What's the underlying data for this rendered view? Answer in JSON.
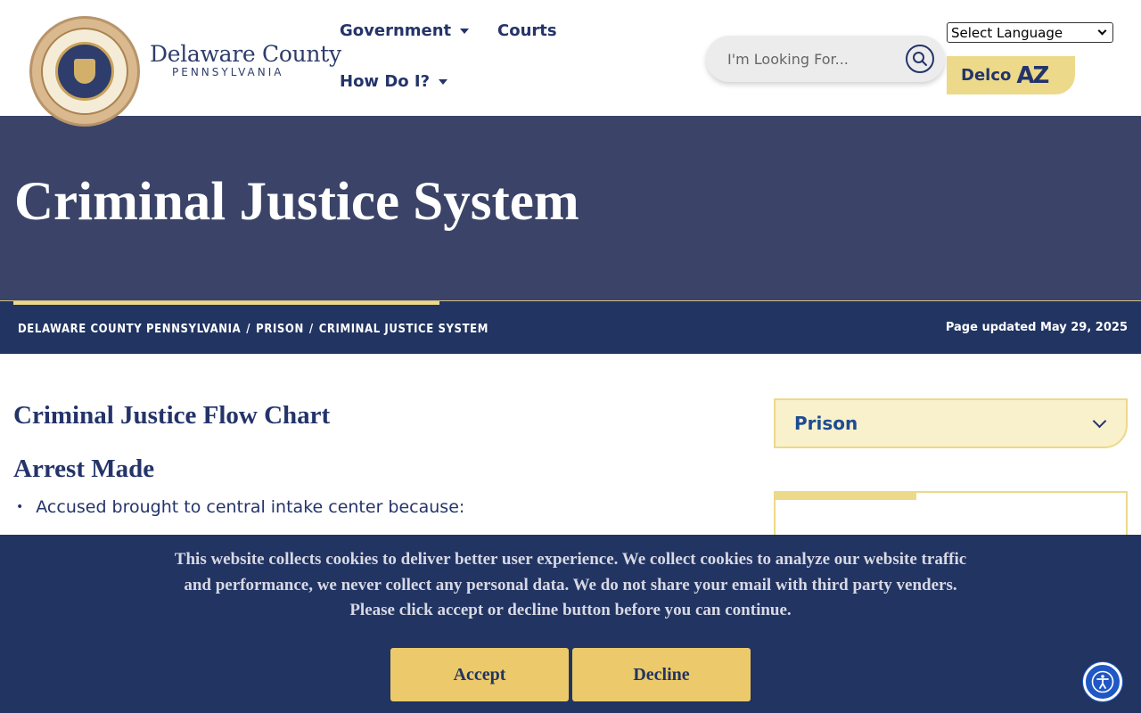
{
  "header": {
    "logo_title": "Delaware County",
    "logo_subtitle": "PENNSYLVANIA",
    "nav": [
      {
        "label": "Government"
      },
      {
        "label": "Courts"
      },
      {
        "label": "How Do I?"
      }
    ],
    "search": {
      "placeholder": "I'm Looking For..."
    },
    "language_select": {
      "selected": "Select Language"
    },
    "delco_az": {
      "label": "Delco",
      "mark": "AZ"
    }
  },
  "hero": {
    "title": "Criminal Justice System"
  },
  "breadcrumb": {
    "items": [
      "DELAWARE COUNTY PENNSYLVANIA",
      "PRISON",
      "CRIMINAL JUSTICE SYSTEM"
    ],
    "separator": "/",
    "updated": "Page updated May 29, 2025"
  },
  "main": {
    "heading": "Criminal Justice Flow Chart",
    "subheading": "Arrest Made",
    "bullets": [
      "Accused brought to central intake center because:"
    ]
  },
  "sidebar": {
    "accordion_label": "Prison"
  },
  "cookie_banner": {
    "lines": [
      "This website collects cookies to deliver better user experience. We collect cookies to analyze our website traffic",
      "and performance, we never collect any personal data. We do not share your email with third party venders.",
      "Please click accept or decline button before you can continue."
    ],
    "accept_label": "Accept",
    "decline_label": "Decline"
  },
  "colors": {
    "navy": "#213462",
    "hero": "#3b4468",
    "gold": "#ecd98a",
    "button_gold": "#ecca6b"
  },
  "icons": [
    "seal-logo",
    "search-icon",
    "chevron-down-icon",
    "accessibility-icon"
  ]
}
